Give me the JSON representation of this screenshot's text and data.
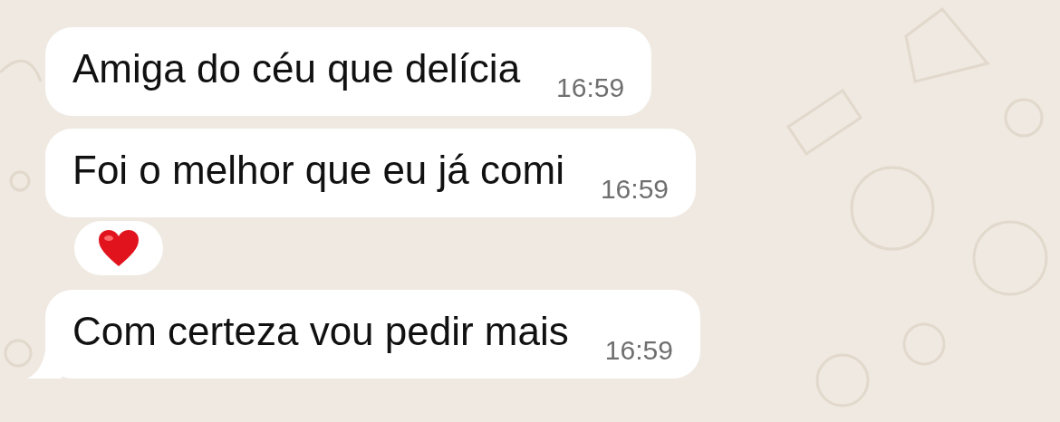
{
  "messages": [
    {
      "text": "Amiga do céu que delícia",
      "time": "16:59",
      "tail": false
    },
    {
      "text": "Foi o melhor que eu já comi",
      "time": "16:59",
      "tail": false,
      "reaction": {
        "kind": "heart"
      }
    },
    {
      "text": "Com certeza vou pedir mais",
      "time": "16:59",
      "tail": true
    }
  ]
}
